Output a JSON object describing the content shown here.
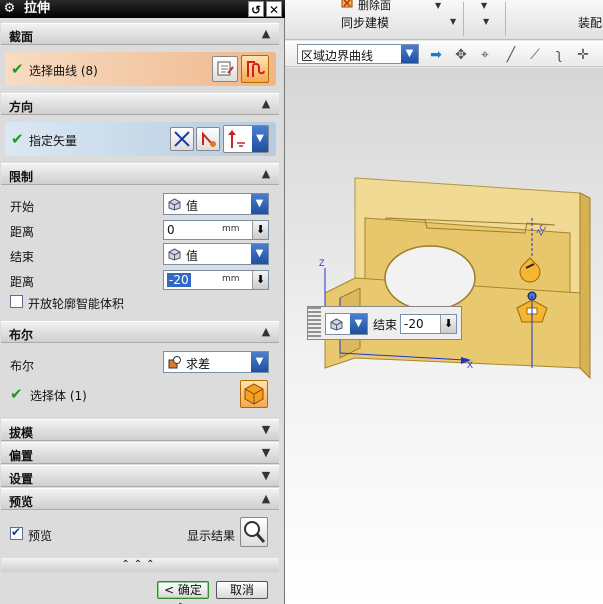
{
  "dialog": {
    "title": "拉伸",
    "sections": {
      "section": "截面",
      "direction": "方向",
      "limits": "限制",
      "boolean": "布尔",
      "draft": "拔模",
      "offset": "偏置",
      "settings": "设置",
      "preview": "预览"
    },
    "select_curve": "选择曲线 (8)",
    "specify_vector": "指定矢量",
    "limits": {
      "start_label": "开始",
      "start_value": "值",
      "distance_label": "距离",
      "start_distance": "0",
      "end_label": "结束",
      "end_value": "值",
      "end_distance": "-20",
      "unit": "mm",
      "open_profile": "开放轮廓智能体积"
    },
    "boolean": {
      "label": "布尔",
      "value": "求差",
      "select_body": "选择体 (1)"
    },
    "preview": {
      "checkbox": "预览",
      "show_result": "显示结果"
    },
    "ok": "< 确定 >",
    "cancel": "取消"
  },
  "toolbar": {
    "delete_face": "删除面",
    "sync_modeling": "同步建模",
    "assembly": "装配",
    "curve_rule": "区域边界曲线"
  },
  "viewport": {
    "end_label": "结束",
    "end_value": "-20",
    "axis_x": "X",
    "axis_z": "Z",
    "axis_zc": "ZC",
    "dim_value": "-20"
  }
}
